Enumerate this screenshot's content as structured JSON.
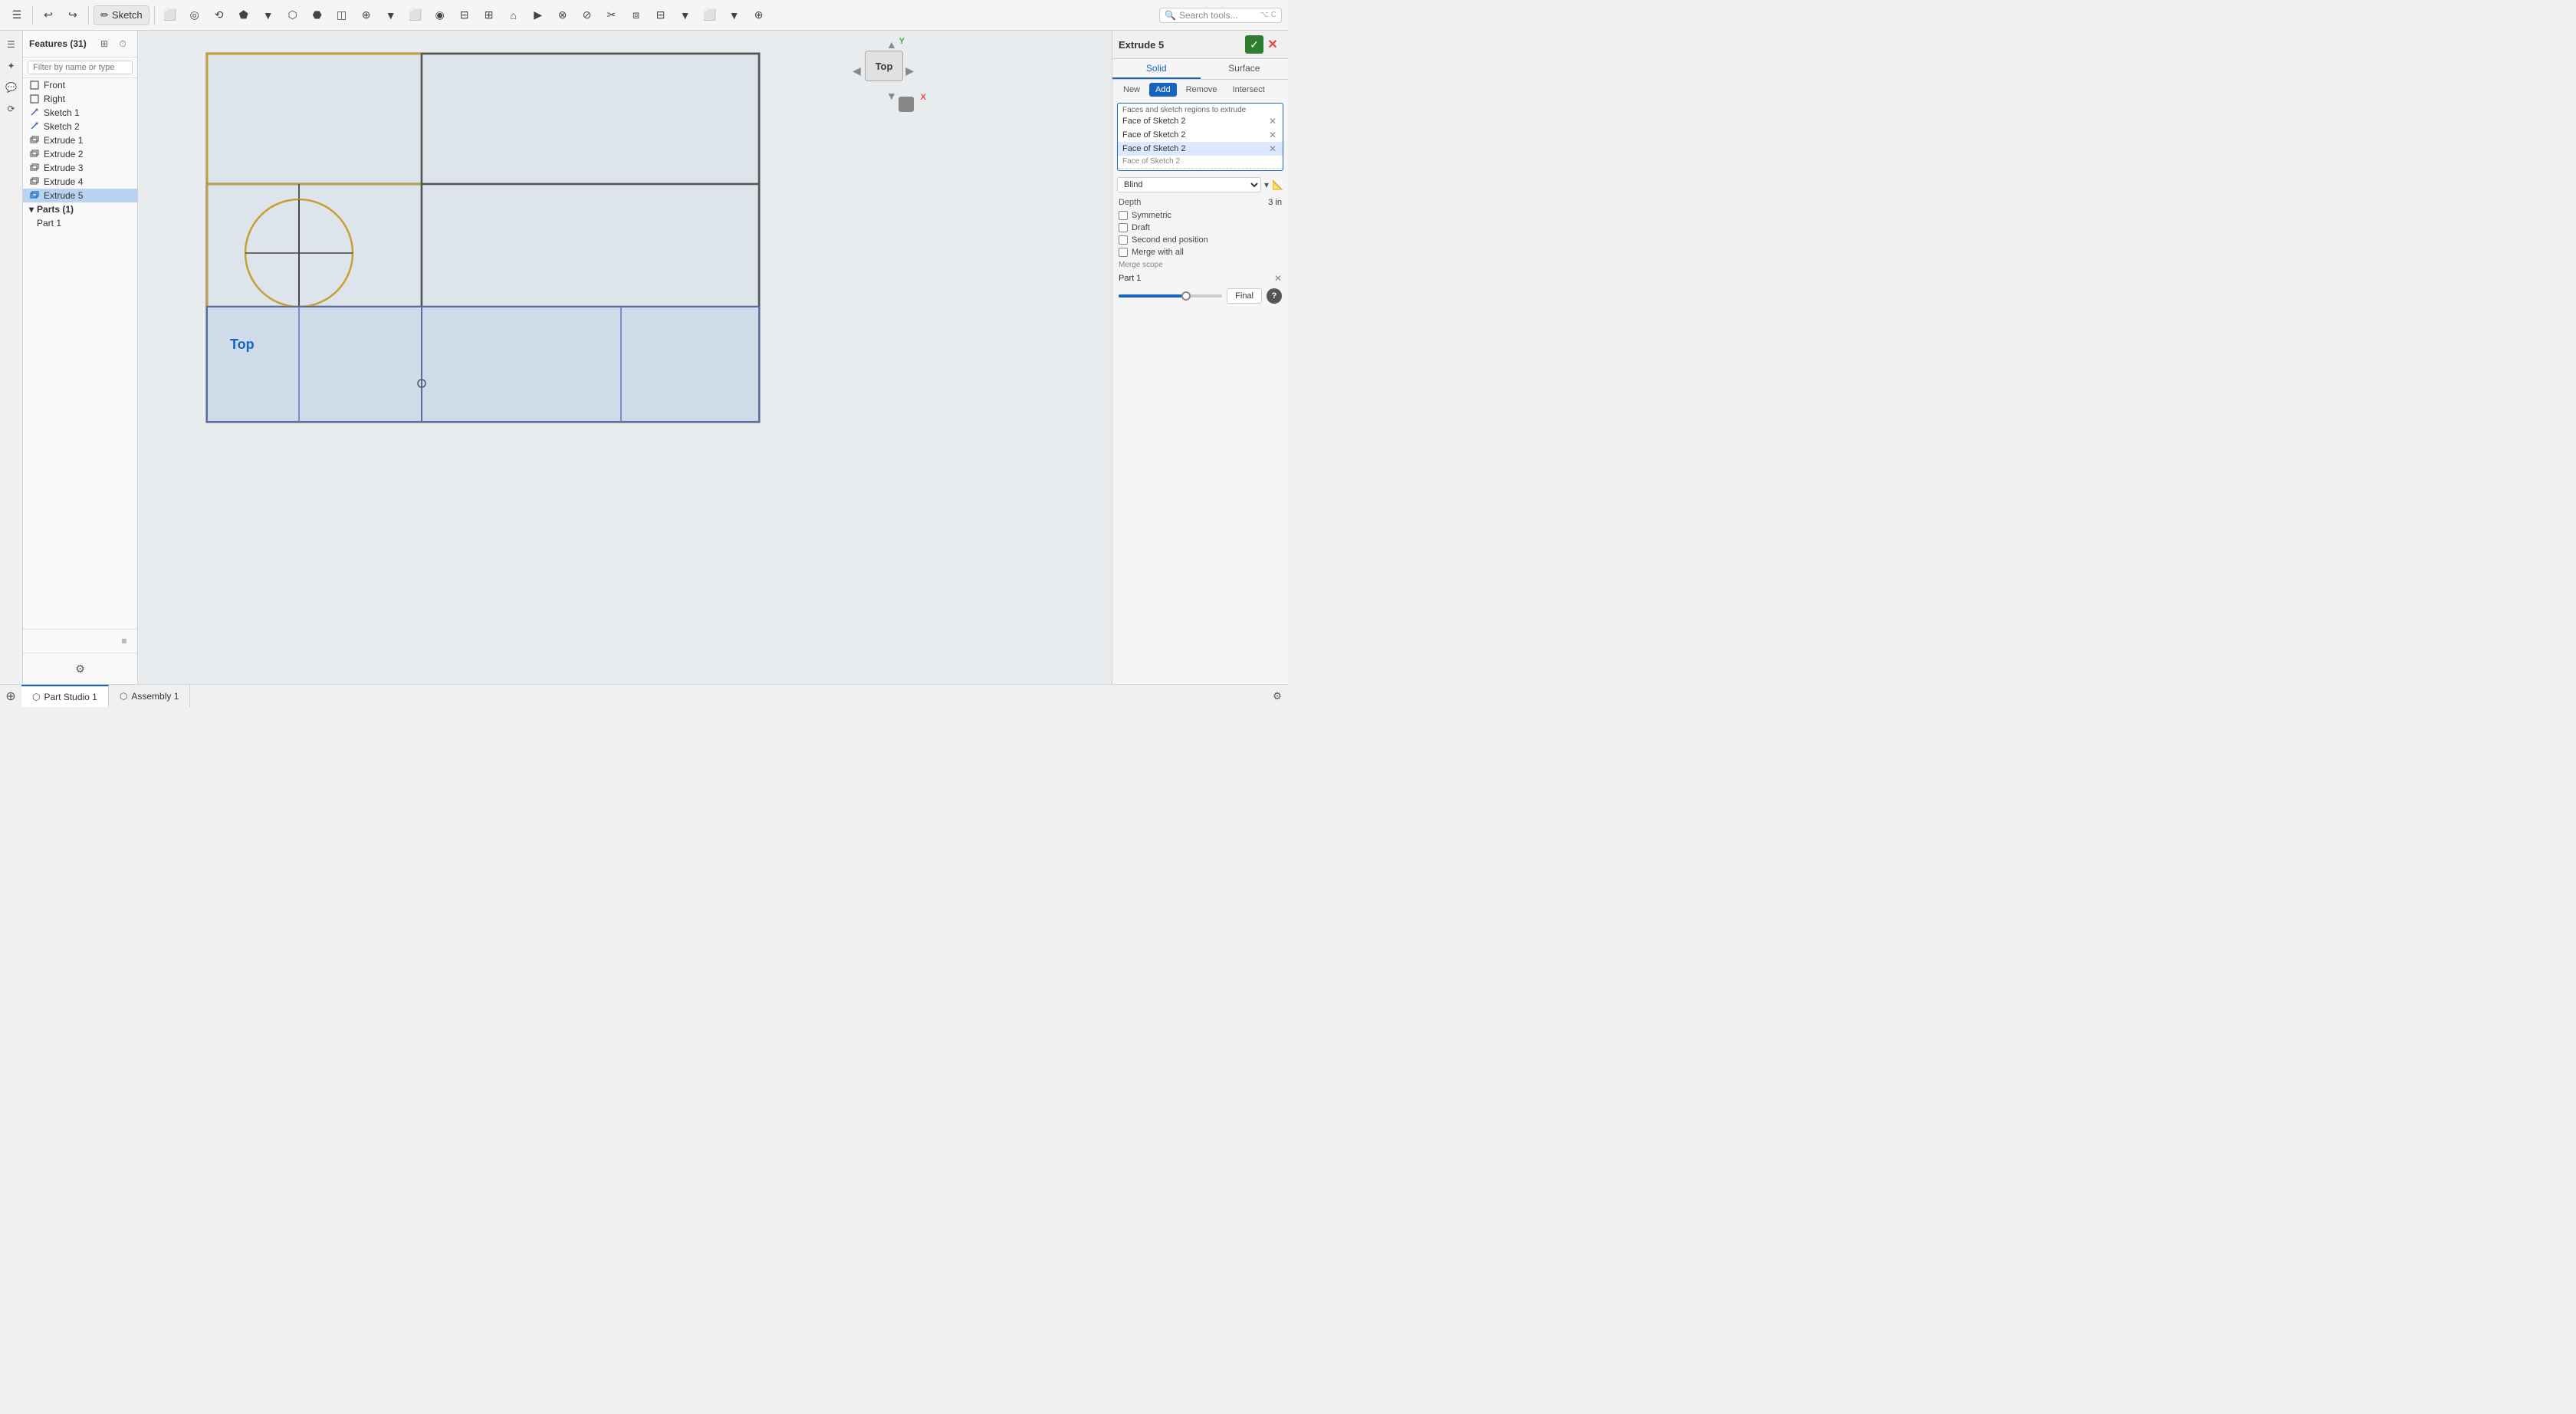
{
  "toolbar": {
    "undo_label": "↩",
    "redo_label": "↪",
    "sketch_label": "Sketch",
    "search_placeholder": "Search tools...",
    "shortcut_hint": "⌥ C"
  },
  "left_panel": {
    "title": "Features (31)",
    "filter_placeholder": "Filter by name or type",
    "items": [
      {
        "id": "front",
        "label": "Front",
        "type": "plane",
        "icon": "□"
      },
      {
        "id": "right",
        "label": "Right",
        "type": "plane",
        "icon": "□"
      },
      {
        "id": "sketch1",
        "label": "Sketch 1",
        "type": "sketch",
        "icon": "✏"
      },
      {
        "id": "sketch2",
        "label": "Sketch 2",
        "type": "sketch",
        "icon": "✏"
      },
      {
        "id": "extrude1",
        "label": "Extrude 1",
        "type": "extrude",
        "icon": "⊞"
      },
      {
        "id": "extrude2",
        "label": "Extrude 2",
        "type": "extrude",
        "icon": "⊞"
      },
      {
        "id": "extrude3",
        "label": "Extrude 3",
        "type": "extrude",
        "icon": "⊞"
      },
      {
        "id": "extrude4",
        "label": "Extrude 4",
        "type": "extrude",
        "icon": "⊞"
      },
      {
        "id": "extrude5",
        "label": "Extrude 5",
        "type": "extrude",
        "icon": "⊞",
        "selected": true
      }
    ],
    "parts_section": "Parts (1)",
    "part1": "Part 1"
  },
  "right_panel": {
    "title": "Extrude 5",
    "confirm_label": "✓",
    "cancel_label": "✕",
    "tab_solid": "Solid",
    "tab_surface": "Surface",
    "subtab_new": "New",
    "subtab_add": "Add",
    "subtab_remove": "Remove",
    "subtab_intersect": "Intersect",
    "faces_label": "Faces and sketch regions to extrude",
    "face1": "Face of Sketch 2",
    "face2": "Face of Sketch 2",
    "face3": "Face of Sketch 2",
    "face_more": "Face of Sketch 2",
    "blind_label": "Blind",
    "depth_label": "Depth",
    "depth_value": "3 in",
    "symmetric_label": "Symmetric",
    "draft_label": "Draft",
    "second_end_position_label": "Second end position",
    "merge_with_all_label": "Merge with all",
    "merge_scope_label": "Merge scope",
    "merge_scope_value": "Part 1",
    "final_label": "Final",
    "help_label": "?"
  },
  "view_cube": {
    "label": "Top",
    "axis_x": "X",
    "axis_y": "Y"
  },
  "canvas": {
    "top_label": "Top"
  },
  "bottom_tabs": [
    {
      "label": "Part Studio 1",
      "icon": "⬡",
      "active": true
    },
    {
      "label": "Assembly 1",
      "icon": "⬡",
      "active": false
    }
  ]
}
